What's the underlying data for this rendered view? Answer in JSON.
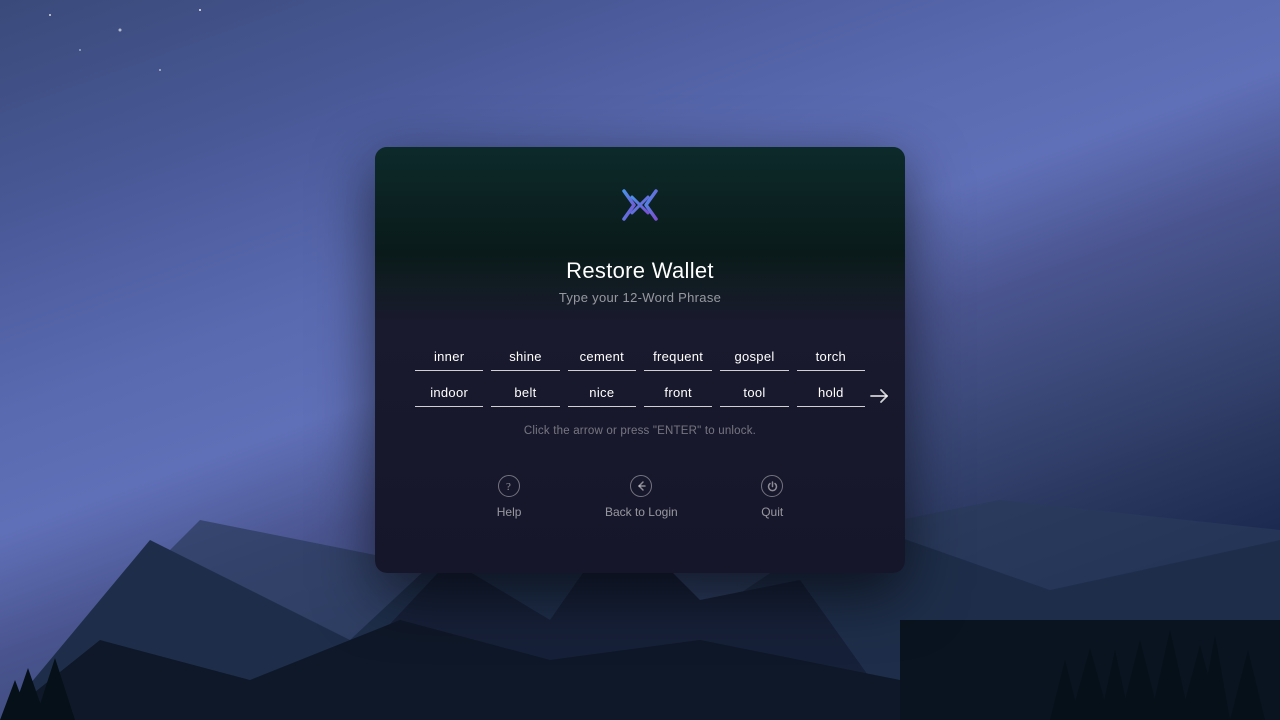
{
  "background": {
    "description": "Yosemite night sky with mountains"
  },
  "modal": {
    "title": "Restore Wallet",
    "subtitle": "Type your 12-Word Phrase",
    "hint": "Click the arrow or press \"ENTER\" to unlock.",
    "words_row1": [
      {
        "id": 1,
        "value": "inner"
      },
      {
        "id": 2,
        "value": "shine"
      },
      {
        "id": 3,
        "value": "cement"
      },
      {
        "id": 4,
        "value": "frequent"
      },
      {
        "id": 5,
        "value": "gospel"
      },
      {
        "id": 6,
        "value": "torch"
      }
    ],
    "words_row2": [
      {
        "id": 7,
        "value": "indoor"
      },
      {
        "id": 8,
        "value": "belt"
      },
      {
        "id": 9,
        "value": "nice"
      },
      {
        "id": 10,
        "value": "front"
      },
      {
        "id": 11,
        "value": "tool"
      },
      {
        "id": 12,
        "value": "hold",
        "active": true
      }
    ],
    "footer": {
      "help_label": "Help",
      "back_label": "Back to Login",
      "quit_label": "Quit"
    }
  }
}
